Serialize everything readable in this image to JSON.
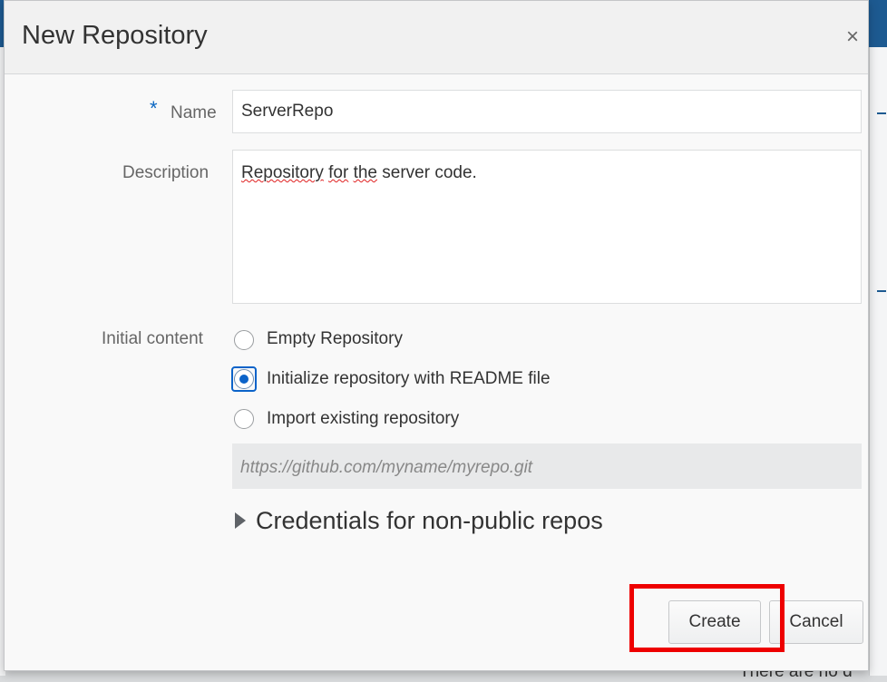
{
  "background": {
    "partial_text": "There are no d"
  },
  "dialog": {
    "title": "New Repository",
    "close_glyph": "×",
    "name": {
      "required_marker": "*",
      "label": "Name",
      "value": "ServerRepo"
    },
    "description": {
      "label": "Description",
      "value_word1": "Repository",
      "value_word2": "for",
      "value_word3": "the",
      "value_rest": "server code."
    },
    "initial_content": {
      "label": "Initial content",
      "options": [
        {
          "label": "Empty Repository",
          "checked": false
        },
        {
          "label": "Initialize repository with README file",
          "checked": true
        },
        {
          "label": "Import existing repository",
          "checked": false
        }
      ],
      "import_url_placeholder": "https://github.com/myname/myrepo.git"
    },
    "credentials_toggle": "Credentials for non-public repos",
    "buttons": {
      "create": "Create",
      "cancel": "Cancel"
    }
  },
  "colors": {
    "accent": "#0b63c9",
    "highlight": "#ee0000",
    "header_bar": "#1d5a91"
  },
  "icons": {
    "close": "close-icon",
    "disclosure": "triangle-right-icon"
  }
}
